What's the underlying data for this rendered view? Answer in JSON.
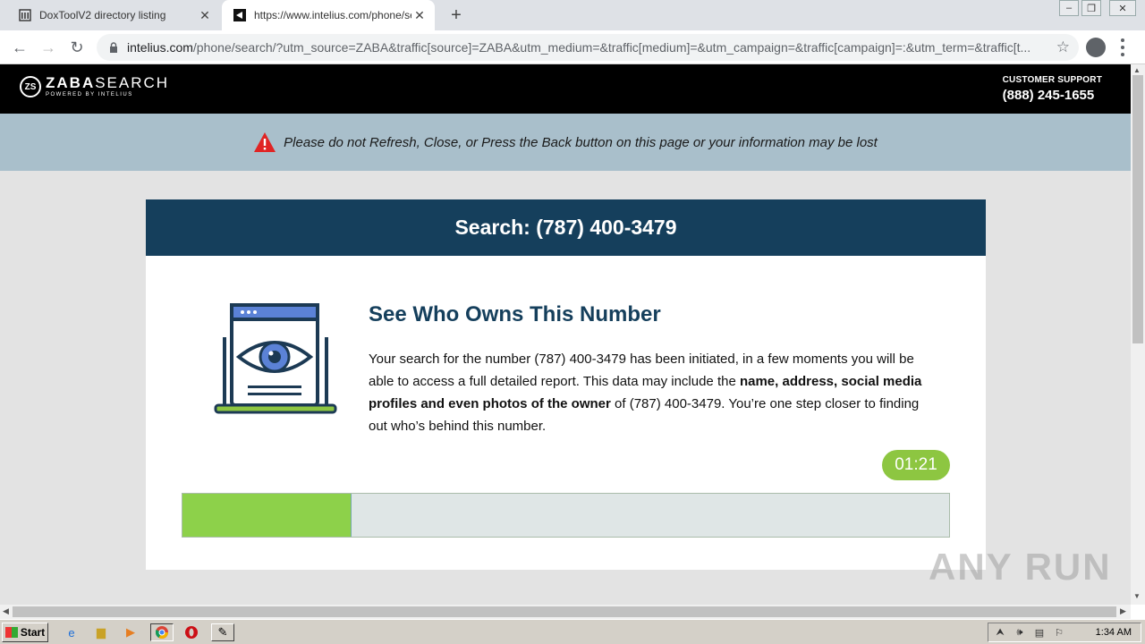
{
  "browser": {
    "tabs": [
      {
        "title": "DoxToolV2 directory listing",
        "active": false,
        "icon": "building-icon"
      },
      {
        "title": "https://www.intelius.com/phone/se",
        "active": true,
        "icon": "zaba-icon"
      }
    ],
    "url_host": "intelius.com",
    "url_rest": "/phone/search/?utm_source=ZABA&traffic[source]=ZABA&utm_medium=&traffic[medium]=&utm_campaign=&traffic[campaign]=:&utm_term=&traffic[t..."
  },
  "site": {
    "logo_main": "ZABA",
    "logo_main2": "SEARCH",
    "logo_sub": "POWERED BY INTELIUS",
    "logo_badge": "ZS",
    "support_label": "CUSTOMER SUPPORT",
    "support_phone": "(888) 245-1655"
  },
  "warning": {
    "message": "Please do not Refresh, Close, or Press the Back button on this page or your information may be lost",
    "color": "#e02424"
  },
  "card": {
    "header": "Search: (787) 400-3479",
    "heading": "See Who Owns This Number",
    "desc_1": "Your search for the number (787) 400-3479 has been initiated, in a few moments you will be able to access a full detailed report. This data may include the ",
    "desc_bold": "name, address, social media profiles and even photos of the owner",
    "desc_2": " of (787) 400-3479. You’re one step closer to finding out who’s behind this number.",
    "timer": "01:21",
    "progress_fraction": 0.22
  },
  "colors": {
    "header_bg": "#153f5c",
    "accent_green": "#8dc641",
    "warnbar_bg": "#a9bfcb"
  },
  "watermark": "ANY RUN",
  "taskbar": {
    "start_label": "Start",
    "clock": "1:34 AM"
  }
}
